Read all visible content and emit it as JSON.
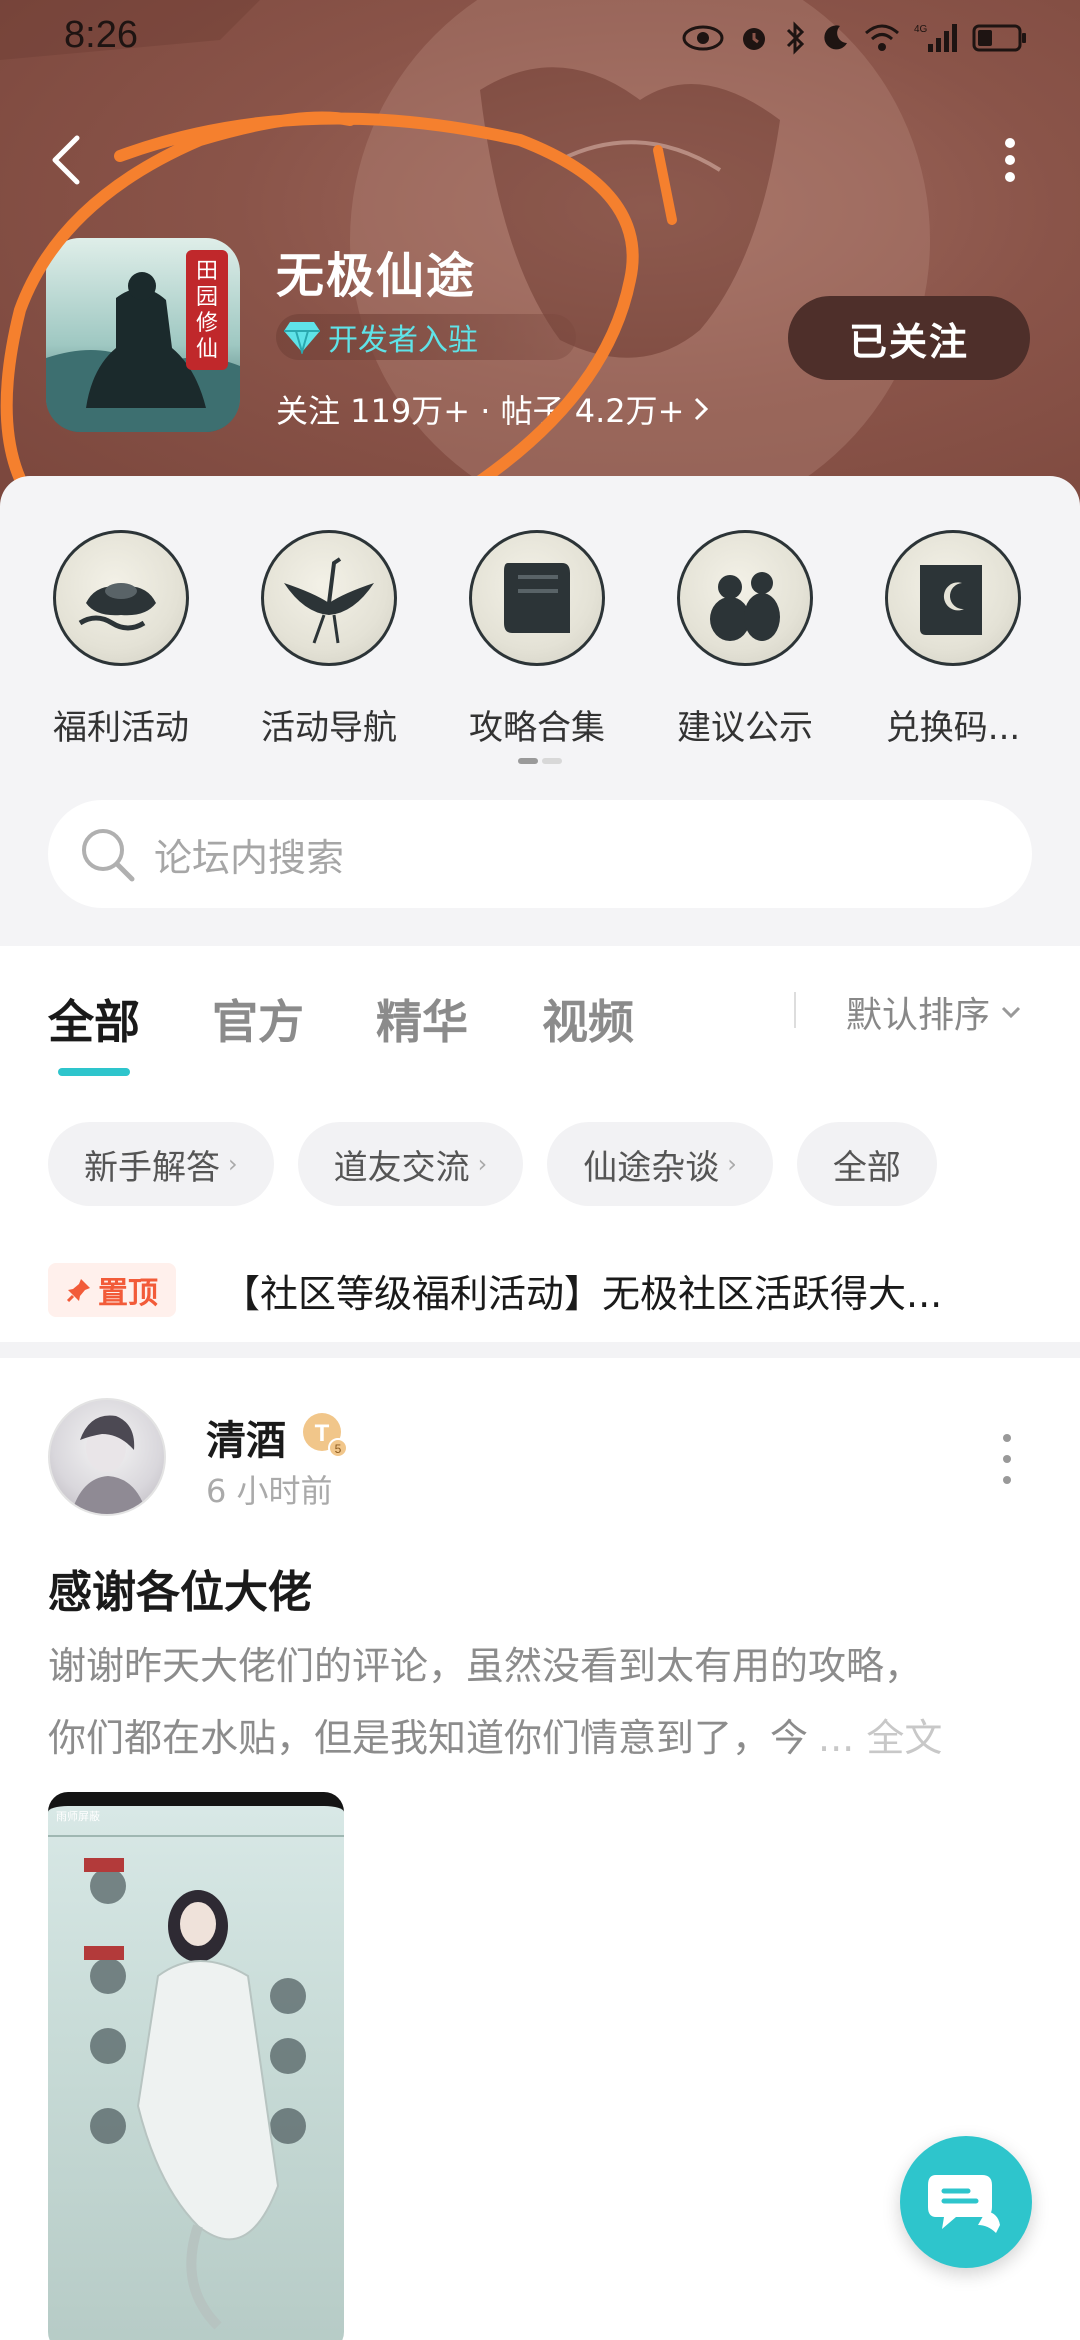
{
  "status_bar": {
    "time": "8:26",
    "network": "4G"
  },
  "header": {
    "app_name": "无极仙途",
    "developer_badge": "开发者入驻",
    "stats": "关注 119万+ · 帖子 4.2万+",
    "follow_button": "已关注"
  },
  "app_icon": {
    "emblem_text": "田园修仙"
  },
  "shortcuts": [
    {
      "label": "福利活动",
      "icon": "gold-ingot-icon"
    },
    {
      "label": "活动导航",
      "icon": "crane-icon"
    },
    {
      "label": "攻略合集",
      "icon": "scroll-icon"
    },
    {
      "label": "建议公示",
      "icon": "gourd-icon"
    },
    {
      "label": "兑换码...",
      "icon": "moon-scroll-icon"
    }
  ],
  "search": {
    "placeholder": "论坛内搜索"
  },
  "tabs": [
    {
      "label": "全部",
      "active": true
    },
    {
      "label": "官方",
      "active": false
    },
    {
      "label": "精华",
      "active": false
    },
    {
      "label": "视频",
      "active": false
    }
  ],
  "sort_label": "默认排序",
  "chips": [
    {
      "label": "新手解答",
      "has_arrow": true
    },
    {
      "label": "道友交流",
      "has_arrow": true
    },
    {
      "label": "仙途杂谈",
      "has_arrow": true
    },
    {
      "label": "全部",
      "has_arrow": false
    }
  ],
  "pinned": {
    "badge": "置顶",
    "title": "【社区等级福利活动】无极社区活跃得大..."
  },
  "post": {
    "author": "清酒",
    "level_badge": "T5",
    "time": "6 小时前",
    "title": "感谢各位大佬",
    "body_line1": "谢谢昨天大佬们的评论，虽然没看到太有用的攻略，",
    "body_line2": "你们都在水贴，但是我知道你们情意到了，今",
    "more_label": "... 全文",
    "image_header": "雨师屏蔽"
  },
  "colors": {
    "accent": "#2ec5cc",
    "hero_bg": "#8a5449",
    "follow_bg": "#4e2f2a",
    "pin_text": "#f25b39",
    "annotation": "#f5802e"
  }
}
